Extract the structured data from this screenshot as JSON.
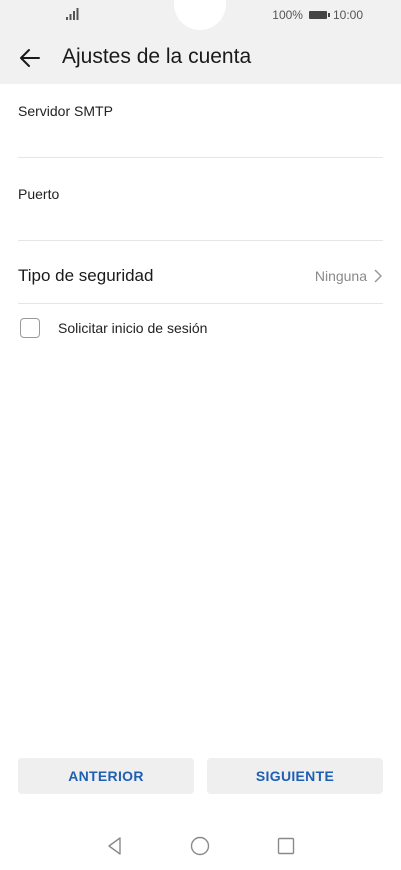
{
  "status_bar": {
    "signal_icon": "signal-bars-icon",
    "battery_percent": "100%",
    "battery_icon": "battery-icon",
    "time": "10:00"
  },
  "header": {
    "back_icon": "arrow-left-icon",
    "title": "Ajustes de la cuenta",
    "background": "#f1f1f1"
  },
  "form": {
    "smtp_server": {
      "label": "Servidor SMTP",
      "value": ""
    },
    "port": {
      "label": "Puerto",
      "value": ""
    },
    "security_type": {
      "label": "Tipo de seguridad",
      "value": "Ninguna",
      "icon": "chevron-right-icon"
    },
    "require_login": {
      "label": "Solicitar inicio de sesión",
      "checked": false
    }
  },
  "buttons": {
    "previous": "ANTERIOR",
    "next": "SIGUIENTE",
    "accent": "#1e5fb4"
  },
  "navigation_bar": {
    "icons": [
      "back-triangle-icon",
      "home-circle-icon",
      "recents-square-icon"
    ]
  }
}
